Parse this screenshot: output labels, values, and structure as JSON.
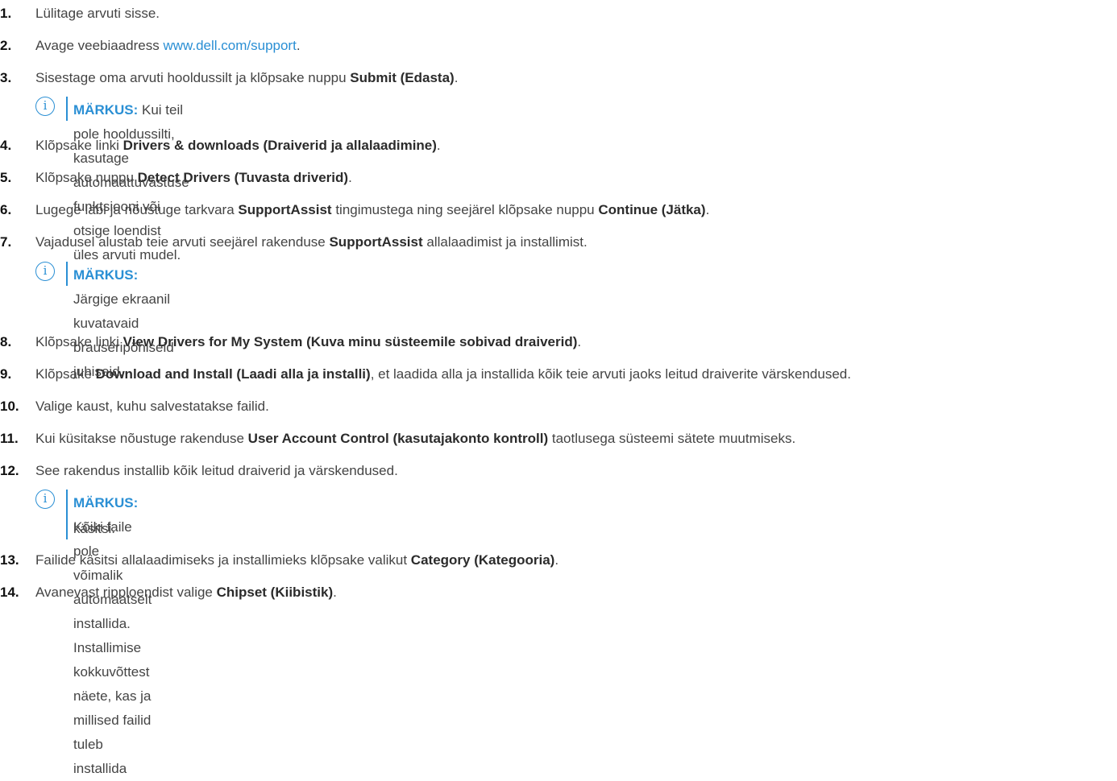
{
  "steps": [
    {
      "num": "1.",
      "parts": [
        {
          "t": "Lülitage arvuti sisse.",
          "s": ""
        }
      ]
    },
    {
      "num": "2.",
      "parts": [
        {
          "t": "Avage veebiaadress ",
          "s": ""
        },
        {
          "t": "www.dell.com/support",
          "s": "link"
        },
        {
          "t": ".",
          "s": ""
        }
      ]
    },
    {
      "num": "3.",
      "parts": [
        {
          "t": "Sisestage oma arvuti hooldussilt ja klõpsake nuppu ",
          "s": ""
        },
        {
          "t": "Submit (Edasta)",
          "s": "b"
        },
        {
          "t": ".",
          "s": ""
        }
      ]
    },
    {
      "num": "4.",
      "parts": [
        {
          "t": "Klõpsake linki ",
          "s": ""
        },
        {
          "t": "Drivers & downloads (Draiverid ja allalaadimine)",
          "s": "b"
        },
        {
          "t": ".",
          "s": ""
        }
      ]
    },
    {
      "num": "5.",
      "parts": [
        {
          "t": "Klõpsake nuppu ",
          "s": ""
        },
        {
          "t": "Detect Drivers (Tuvasta driverid)",
          "s": "b"
        },
        {
          "t": ".",
          "s": ""
        }
      ]
    },
    {
      "num": "6.",
      "parts": [
        {
          "t": "Lugege läbi ja nõustuge tarkvara ",
          "s": ""
        },
        {
          "t": "SupportAssist",
          "s": "b"
        },
        {
          "t": " tingimustega ning seejärel klõpsake nuppu ",
          "s": ""
        },
        {
          "t": "Continue (Jätka)",
          "s": "b"
        },
        {
          "t": ".",
          "s": ""
        }
      ]
    },
    {
      "num": "7.",
      "parts": [
        {
          "t": "Vajadusel alustab teie arvuti seejärel rakenduse ",
          "s": ""
        },
        {
          "t": "SupportAssist",
          "s": "b"
        },
        {
          "t": " allalaadimist ja installimist.",
          "s": ""
        }
      ]
    },
    {
      "num": "8.",
      "parts": [
        {
          "t": "Klõpsake linki ",
          "s": ""
        },
        {
          "t": "View Drivers for My System (Kuva minu süsteemile sobivad draiverid)",
          "s": "b"
        },
        {
          "t": ".",
          "s": ""
        }
      ]
    },
    {
      "num": "9.",
      "parts": [
        {
          "t": "Klõpsake ",
          "s": ""
        },
        {
          "t": "Download and Install (Laadi alla ja installi)",
          "s": "b"
        },
        {
          "t": ", et laadida alla ja installida kõik teie arvuti jaoks leitud draiverite värskendused.",
          "s": ""
        }
      ]
    },
    {
      "num": "10.",
      "parts": [
        {
          "t": "Valige kaust, kuhu salvestatakse failid.",
          "s": ""
        }
      ]
    },
    {
      "num": "11.",
      "parts": [
        {
          "t": "Kui küsitakse nõustuge rakenduse ",
          "s": ""
        },
        {
          "t": "User Account Control (kasutajakonto kontroll)",
          "s": "b"
        },
        {
          "t": " taotlusega süsteemi sätete muutmiseks.",
          "s": ""
        }
      ]
    },
    {
      "num": "12.",
      "parts": [
        {
          "t": "See rakendus installib kõik leitud draiverid ja värskendused.",
          "s": ""
        }
      ]
    },
    {
      "num": "13.",
      "parts": [
        {
          "t": "Failide käsitsi allalaadimiseks ja installimieks klõpsake valikut ",
          "s": ""
        },
        {
          "t": "Category (Kategooria)",
          "s": "b"
        },
        {
          "t": ".",
          "s": ""
        }
      ]
    },
    {
      "num": "14.",
      "parts": [
        {
          "t": "Avanevast ripploendist valige ",
          "s": ""
        },
        {
          "t": "Chipset (Kiibistik)",
          "s": "b"
        },
        {
          "t": ".",
          "s": ""
        }
      ]
    }
  ],
  "notes": [
    {
      "icon": "i",
      "label": "MÄRKUS:",
      "lines": [
        " Kui teil pole hooldussilti, kasutage automaattuvastuse funktsiooni või otsige loendist üles arvuti mudel."
      ]
    },
    {
      "icon": "i",
      "label": "MÄRKUS:",
      "lines": [
        " Järgige ekraanil kuvatavaid brauseripõhiseid juhiseid."
      ]
    },
    {
      "icon": "i",
      "label": "MÄRKUS:",
      "lines": [
        " Kõiki faile pole võimalik automaatselt installida. Installimise kokkuvõttest näete, kas ja millised failid tuleb installida",
        "käsitsi."
      ]
    }
  ]
}
